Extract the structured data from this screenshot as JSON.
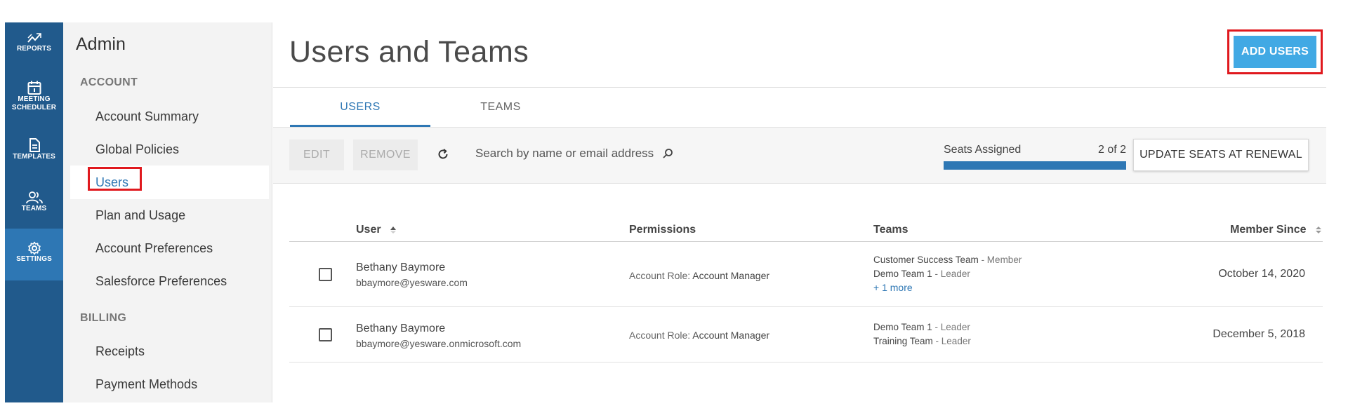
{
  "rail": {
    "items": [
      {
        "label": "REPORTS",
        "icon": "reports-icon"
      },
      {
        "label": "MEETING SCHEDULER",
        "icon": "calendar-icon"
      },
      {
        "label": "TEMPLATES",
        "icon": "document-icon"
      },
      {
        "label": "TEAMS",
        "icon": "people-icon"
      },
      {
        "label": "SETTINGS",
        "icon": "gear-icon"
      }
    ],
    "active": "SETTINGS"
  },
  "sidebar": {
    "title": "Admin",
    "sections": [
      {
        "heading": "ACCOUNT",
        "items": [
          "Account Summary",
          "Global Policies",
          "Users",
          "Plan and Usage",
          "Account Preferences",
          "Salesforce Preferences"
        ]
      },
      {
        "heading": "BILLING",
        "items": [
          "Receipts",
          "Payment Methods"
        ]
      }
    ],
    "active": "Users"
  },
  "header": {
    "title": "Users and Teams",
    "add_users": "ADD USERS"
  },
  "tabs": [
    {
      "label": "USERS",
      "active": true
    },
    {
      "label": "TEAMS",
      "active": false
    }
  ],
  "toolbar": {
    "edit": "EDIT",
    "remove": "REMOVE",
    "search_placeholder": "Search by name or email address",
    "seats_label": "Seats Assigned",
    "seats_value": "2 of 2",
    "seats_fraction": 1.0,
    "update_seats": "UPDATE SEATS AT RENEWAL"
  },
  "table": {
    "columns": [
      "User",
      "Permissions",
      "Teams",
      "Member Since"
    ],
    "rows": [
      {
        "name": "Bethany Baymore",
        "email": "bbaymore@yesware.com",
        "role_label": "Account Role:",
        "role": "Account Manager",
        "teams": [
          {
            "team": "Customer Success Team",
            "role": " - Member"
          },
          {
            "team": "Demo Team 1",
            "role": " - Leader"
          }
        ],
        "more": "+ 1 more",
        "since": "October 14, 2020"
      },
      {
        "name": "Bethany Baymore",
        "email": "bbaymore@yesware.onmicrosoft.com",
        "role_label": "Account Role:",
        "role": "Account Manager",
        "teams": [
          {
            "team": "Demo Team 1",
            "role": " - Leader"
          },
          {
            "team": "Training Team",
            "role": " - Leader"
          }
        ],
        "since": "December 5, 2018"
      }
    ]
  },
  "colors": {
    "rail": "#215a8c",
    "rail_active": "#2e77b4",
    "accent": "#2e77b4",
    "add_button": "#41a9e4",
    "highlight": "#e0191e"
  }
}
